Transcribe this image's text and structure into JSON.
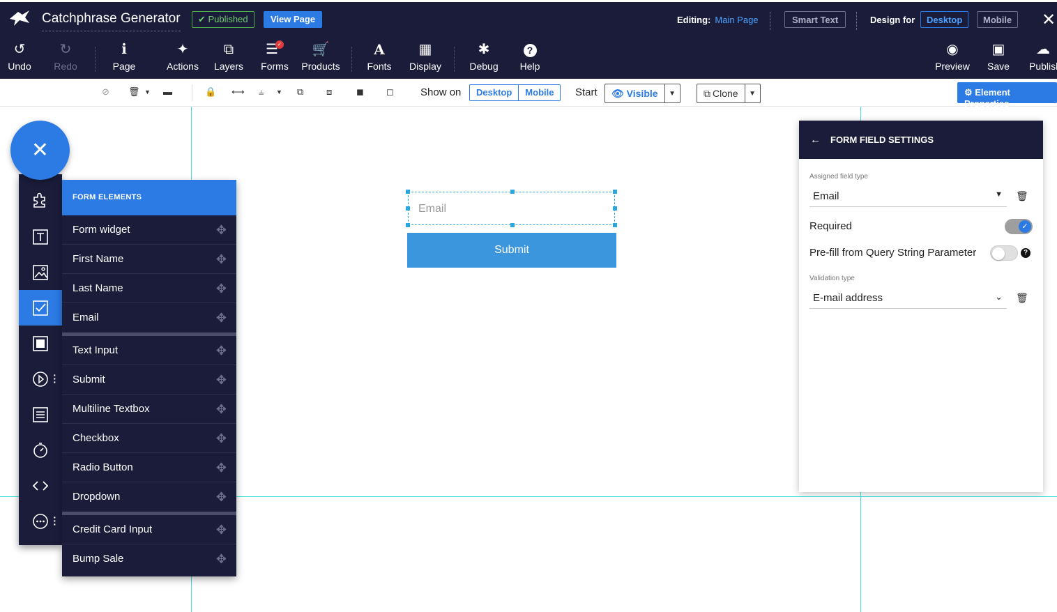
{
  "header": {
    "app_title": "Catchphrase Generator",
    "published_label": "✔ Published",
    "view_page_label": "View Page",
    "editing_label": "Editing:",
    "editing_page": "Main Page",
    "smart_text_label": "Smart Text",
    "design_for_label": "Design for",
    "design_for_options": [
      "Desktop",
      "Mobile"
    ],
    "close_label": "✕"
  },
  "toolbar": {
    "tools": [
      {
        "label": "Undo",
        "icon": "undo-icon",
        "glyph": "↺"
      },
      {
        "label": "Redo",
        "icon": "redo-icon",
        "glyph": "↻"
      },
      {
        "label": "Page",
        "icon": "info-icon",
        "glyph": "ℹ"
      },
      {
        "label": "Actions",
        "icon": "magic-wand-icon",
        "glyph": "✦"
      },
      {
        "label": "Layers",
        "icon": "layers-icon",
        "glyph": "⧉"
      },
      {
        "label": "Forms",
        "icon": "forms-icon",
        "glyph": "☰"
      },
      {
        "label": "Products",
        "icon": "cart-icon",
        "glyph": "🛒"
      },
      {
        "label": "Fonts",
        "icon": "font-icon",
        "glyph": "A"
      },
      {
        "label": "Display",
        "icon": "grid-icon",
        "glyph": "▦"
      },
      {
        "label": "Debug",
        "icon": "bug-icon",
        "glyph": "✱"
      },
      {
        "label": "Help",
        "icon": "help-icon",
        "glyph": "?"
      },
      {
        "label": "Preview",
        "icon": "eye-icon",
        "glyph": "◉"
      },
      {
        "label": "Save",
        "icon": "save-icon",
        "glyph": "▣"
      },
      {
        "label": "Publish",
        "icon": "cloud-upload-icon",
        "glyph": "☁"
      }
    ]
  },
  "toolbar2": {
    "show_on_label": "Show on",
    "show_on_options": [
      "Desktop",
      "Mobile"
    ],
    "start_label": "Start",
    "visible_label": "👁 Visible",
    "clone_label": "Clone",
    "element_properties_label": "⚙ Element Properties"
  },
  "form_elements": {
    "header": "FORM ELEMENTS",
    "groups": [
      [
        "Form widget",
        "First Name",
        "Last Name",
        "Email"
      ],
      [
        "Text Input",
        "Submit",
        "Multiline Textbox",
        "Checkbox",
        "Radio Button",
        "Dropdown"
      ],
      [
        "Credit Card Input",
        "Bump Sale"
      ]
    ]
  },
  "canvas": {
    "email_placeholder": "Email",
    "submit_label": "Submit"
  },
  "settings": {
    "title": "FORM FIELD SETTINGS",
    "assigned_field_type_label": "Assigned field type",
    "assigned_field_type_value": "Email",
    "required_label": "Required",
    "required_on": true,
    "prefill_label": "Pre-fill from Query String Parameter",
    "prefill_on": false,
    "validation_type_label": "Validation type",
    "validation_type_value": "E-mail address"
  },
  "colors": {
    "dark": "#1b1c3a",
    "accent": "#2c7be5",
    "guide": "#40e0e0"
  }
}
